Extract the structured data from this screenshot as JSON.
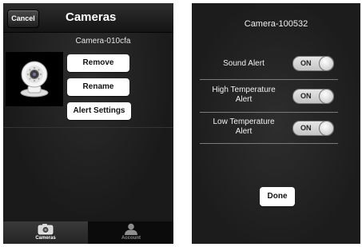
{
  "left_screen": {
    "nav": {
      "cancel_label": "Cancel",
      "title": "Cameras"
    },
    "camera": {
      "name": "Camera-010cfa",
      "thumbnail_icon": "baby-monitor-camera-icon"
    },
    "actions": {
      "remove_label": "Remove",
      "rename_label": "Rename",
      "alert_settings_label": "Alert Settings"
    },
    "tabs": [
      {
        "label": "Cameras",
        "icon": "camera-icon",
        "active": true
      },
      {
        "label": "Account",
        "icon": "person-icon",
        "active": false
      }
    ]
  },
  "right_screen": {
    "camera_name": "Camera-100532",
    "settings": [
      {
        "label_lines": [
          "Sound Alert"
        ],
        "value": "ON"
      },
      {
        "label_lines": [
          "High Temperature",
          "Alert"
        ],
        "value": "ON"
      },
      {
        "label_lines": [
          "Low Temperature",
          "Alert"
        ],
        "value": "ON"
      }
    ],
    "done_label": "Done"
  },
  "colors": {
    "background_dark": "#1a1a1a",
    "button_white": "#ffffff",
    "toggle_track": "#d4d4d4"
  }
}
